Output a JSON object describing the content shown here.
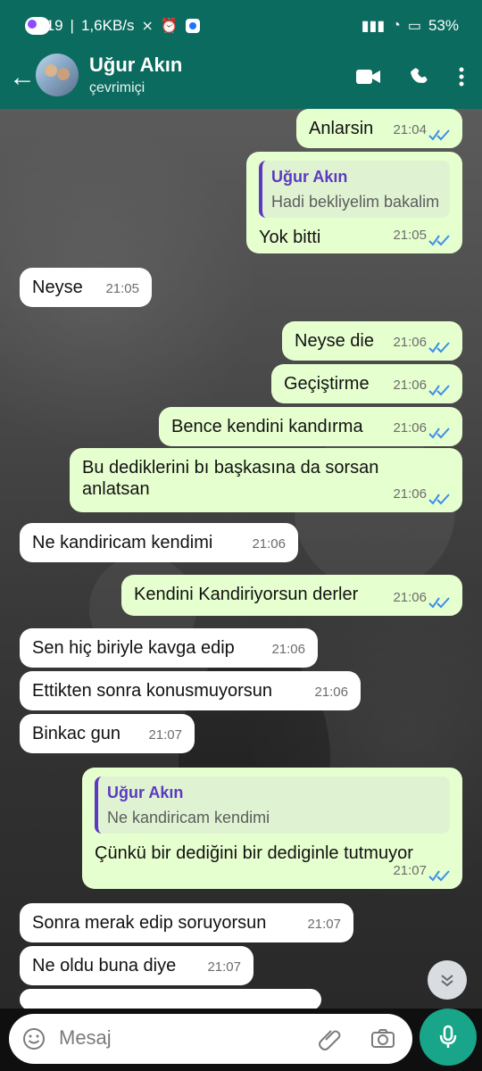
{
  "status_bar": {
    "time": "21:19",
    "speed": "1,6KB/s",
    "battery": "53"
  },
  "header": {
    "name": "Uğur Akın",
    "status": "çevrimiçi"
  },
  "messages": [
    {
      "text": "Anlarsin",
      "time": "21:04",
      "side": "out"
    },
    {
      "quote_name": "Uğur Akın",
      "quote_text": "Hadi bekliyelim bakalim",
      "text": "Yok bitti",
      "time": "21:05",
      "side": "out"
    },
    {
      "text": "Neyse",
      "time": "21:05",
      "side": "in"
    },
    {
      "text": "Neyse die",
      "time": "21:06",
      "side": "out"
    },
    {
      "text": "Geçiştirme",
      "time": "21:06",
      "side": "out"
    },
    {
      "text": "Bence kendini kandırma",
      "time": "21:06",
      "side": "out"
    },
    {
      "text": "Bu dediklerini bı başkasına da sorsan anlatsan",
      "time": "21:06",
      "side": "out"
    },
    {
      "text": "Ne kandiricam kendimi",
      "time": "21:06",
      "side": "in"
    },
    {
      "text": "Kendini Kandiriyorsun derler",
      "time": "21:06",
      "side": "out"
    },
    {
      "text": "Sen hiç biriyle kavga edip",
      "time": "21:06",
      "side": "in"
    },
    {
      "text": "Ettikten sonra konusmuyorsun",
      "time": "21:06",
      "side": "in"
    },
    {
      "text": "Binkac gun",
      "time": "21:07",
      "side": "in"
    },
    {
      "quote_name": "Uğur Akın",
      "quote_text": "Ne kandiricam kendimi",
      "text": "Çünkü bir dediğini bir dediginle tutmuyor",
      "time": "21:07",
      "side": "out"
    },
    {
      "text": "Sonra merak edip soruyorsun",
      "time": "21:07",
      "side": "in"
    },
    {
      "text": "Ne oldu buna diye",
      "time": "21:07",
      "side": "in"
    }
  ],
  "composer": {
    "placeholder": "Mesaj"
  },
  "colors": {
    "accent": "#0b6b5f",
    "bubble_in": "#ffffff",
    "bubble_out": "#e6ffcf",
    "tick": "#3d8ee8",
    "mic": "#19a589"
  },
  "icons": {
    "back": "arrow-left-icon",
    "video": "video-call-icon",
    "phone": "phone-icon",
    "more": "more-vertical-icon",
    "scroll": "chevrons-down-icon",
    "emoji": "emoji-icon",
    "attach": "paperclip-icon",
    "camera": "camera-icon",
    "mic": "microphone-icon"
  }
}
